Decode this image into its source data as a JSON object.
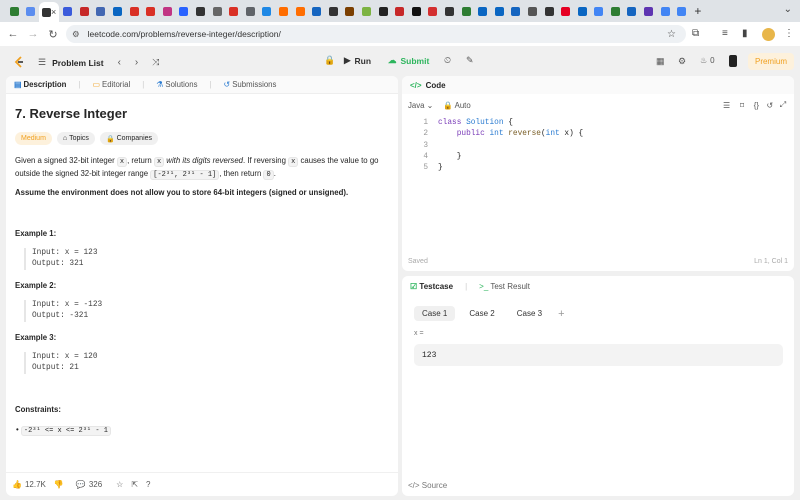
{
  "browser": {
    "url": "leetcode.com/problems/reverse-integer/description/",
    "tab_close": "×",
    "new_tab": "+",
    "favicon_colors": [
      "#2e7d32",
      "#5b8def",
      "#333333",
      "#3b5bdb",
      "#c62828",
      "#4267b2",
      "#0a66c2",
      "#d93025",
      "#d93025",
      "#c13584",
      "#2962ff",
      "#333333",
      "#666666",
      "#d93025",
      "#5f6368",
      "#1e88e5",
      "#ff6d00",
      "#ff6d00",
      "#1565c0",
      "#333333",
      "#7b3f00",
      "#7cb342",
      "#222222",
      "#c62828",
      "#111111",
      "#d32f2f",
      "#333333",
      "#2e7d32",
      "#0a66c2",
      "#0a66c2",
      "#1565c0",
      "#555555",
      "#333333",
      "#e60023",
      "#0a66c2",
      "#4285f4",
      "#2e7d32",
      "#1565c0",
      "#5e35b1",
      "#4285f4",
      "#4285f4"
    ]
  },
  "header": {
    "problem_list": "Problem List",
    "run": "Run",
    "submit": "Submit",
    "streak": "0",
    "premium": "Premium"
  },
  "left": {
    "tabs": [
      "Description",
      "Editorial",
      "Solutions",
      "Submissions"
    ],
    "title": "7. Reverse Integer",
    "difficulty": "Medium",
    "topics": "Topics",
    "companies": "Companies",
    "desc_1a": "Given a signed 32-bit integer ",
    "desc_x": "x",
    "desc_1b": ", return ",
    "desc_x2": "x",
    "desc_1c": " with its digits reversed",
    "desc_1d": ". If reversing ",
    "desc_x3": "x",
    "desc_1e": " causes the value to go",
    "desc_2a": "outside the signed 32-bit integer range ",
    "desc_range": "[-2³¹, 2³¹ - 1]",
    "desc_2b": ", then return ",
    "desc_zero": "0",
    "desc_2c": ".",
    "assume": "Assume the environment does not allow you to store 64-bit integers (signed or unsigned).",
    "examples": [
      {
        "head": "Example 1:",
        "input": "Input: x = 123",
        "output": "Output: 321"
      },
      {
        "head": "Example 2:",
        "input": "Input: x = -123",
        "output": "Output: -321"
      },
      {
        "head": "Example 3:",
        "input": "Input: x = 120",
        "output": "Output: 21"
      }
    ],
    "constraints_head": "Constraints:",
    "constraint": "-2³¹ <= x <= 2³¹ - 1",
    "likes": "12.7K",
    "comments": "326"
  },
  "code": {
    "head": "Code",
    "lang": "Java",
    "auto": "Auto",
    "lines": [
      {
        "n": "1",
        "t": "class Solution {"
      },
      {
        "n": "2",
        "t": "    public int reverse(int x) {"
      },
      {
        "n": "3",
        "t": ""
      },
      {
        "n": "4",
        "t": "    }"
      },
      {
        "n": "5",
        "t": "}"
      }
    ],
    "saved": "Saved",
    "cursor": "Ln 1, Col 1"
  },
  "test": {
    "tab1": "Testcase",
    "tab2": "Test Result",
    "cases": [
      "Case 1",
      "Case 2",
      "Case 3"
    ],
    "add": "+",
    "var_label": "x =",
    "var_value": "123",
    "source": "Source"
  }
}
